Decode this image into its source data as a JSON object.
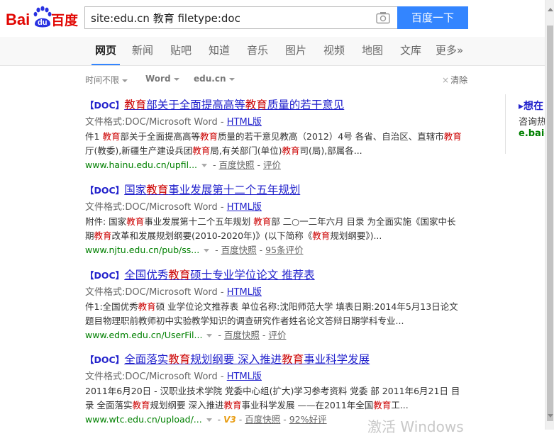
{
  "logo": {
    "text_bai": "Bai",
    "text_du": "du",
    "text_cn": "百度"
  },
  "search": {
    "query": "site:edu.cn 教育 filetype:doc",
    "button_label": "百度一下"
  },
  "nav_tabs": [
    {
      "label": "网页"
    },
    {
      "label": "新闻"
    },
    {
      "label": "贴吧"
    },
    {
      "label": "知道"
    },
    {
      "label": "音乐"
    },
    {
      "label": "图片"
    },
    {
      "label": "视频"
    },
    {
      "label": "地图"
    },
    {
      "label": "文库"
    },
    {
      "label": "更多»"
    }
  ],
  "filters": {
    "time": "时间不限",
    "filetype": "Word",
    "site": "edu.cn",
    "clear": "清除"
  },
  "results": [
    {
      "tag": "【DOC】",
      "t1": "教育",
      "t2": "部关于全面提高高等",
      "t3": "教育",
      "t4": "质量的若干意见",
      "format_label": "文件格式:DOC/Microsoft Word - ",
      "html_label": "HTML版",
      "a1": "件1 ",
      "a2": "教育",
      "a3": "部关于全面提高高等",
      "a4": "教育",
      "a5": "质量的若干意见教高（2012）4号 各省、自治区、直辖市",
      "a6": "教育",
      "a7": "厅(教委),新疆生产建设兵团",
      "a8": "教育",
      "a9": "局,有关部门(单位)",
      "a10": "教育",
      "a11": "司(局),部属各...",
      "url": "www.hainu.edu.cn/upfil...",
      "cache": "百度快照",
      "eval": "评价"
    },
    {
      "tag": "【DOC】",
      "t1": "国家",
      "t2": "教育",
      "t3": "事业发展第十二个五年规划",
      "format_label": "文件格式:DOC/Microsoft Word - ",
      "html_label": "HTML版",
      "a1": "附件: 国家",
      "a2": "教育",
      "a3": "事业发展第十二个五年规划 ",
      "a4": "教育",
      "a5": "部 二○一二年六月 目录 为全面实施《国家中长",
      "a6": "期",
      "a7": "教育",
      "a8": "改革和发展规划纲要(2010-2020年)》(以下简称《",
      "a9": "教育",
      "a10": "规划纲要》)...",
      "url": "www.njtu.edu.cn/pub/ss...",
      "cache": "百度快照",
      "eval": "95条评价"
    },
    {
      "tag": "【DOC】",
      "t1": "全国优秀",
      "t2": "教育",
      "t3": "硕士专业学位论文 推荐表",
      "format_label": "文件格式:DOC/Microsoft Word - ",
      "html_label": "HTML版",
      "a1": "件1:全国优秀",
      "a2": "教育",
      "a3": "硕 业学位论文推荐表 单位名称:沈阳师范大学 填表日期:2014年5月13日论文",
      "a4": "题目物理职前教师初中实验教学知识的调查研究作者姓名论文答辩日期学科专业...",
      "url": "www.edm.edu.cn/UserFil...",
      "cache": "百度快照",
      "eval": "评价"
    },
    {
      "tag": "【DOC】",
      "t1": "全面落实",
      "t2": "教育",
      "t3": "规划纲要 深入推进",
      "t4": "教育",
      "t5": "事业科学发展",
      "format_label": "文件格式:DOC/Microsoft Word - ",
      "html_label": "HTML版",
      "a1": "2011年6月20日 - 汉职业技术学院 党委中心组(扩大)学习参考资料 党委 部 2011年6月21日 目",
      "a2": "录 全面落实",
      "a3": "教育",
      "a4": "规划纲要 深入推进",
      "a5": "教育",
      "a6": "事业科学发展 ——在2011年全国",
      "a7": "教育",
      "a8": "工...",
      "url": "www.wtc.edu.cn/upload/...",
      "v3": "V3",
      "cache": "百度快照",
      "eval": "92%好评"
    }
  ],
  "right_panel": {
    "title": "▸想在",
    "sub": "咨询热",
    "url": "e.baidu"
  },
  "watermark": "激活 Windows",
  "colors": {
    "brand_blue": "#3385ff",
    "logo_red": "#e10602",
    "link_blue": "#2222cc",
    "highlight_red": "#cc0000",
    "url_green": "#008000"
  }
}
